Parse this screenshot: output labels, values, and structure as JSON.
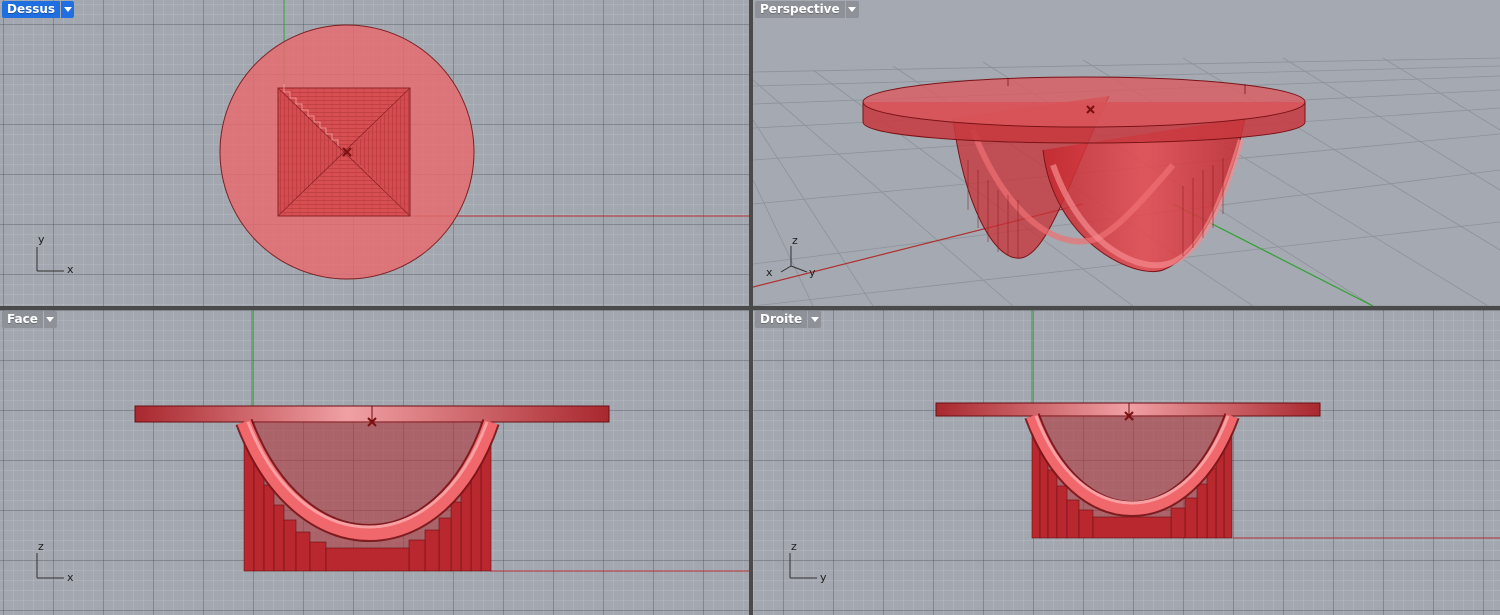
{
  "viewports": {
    "top": {
      "title": "Dessus",
      "active": true,
      "axes": [
        "y",
        "x"
      ]
    },
    "perspective": {
      "title": "Perspective",
      "active": false,
      "axes": [
        "z",
        "x",
        "y"
      ]
    },
    "front": {
      "title": "Face",
      "active": false,
      "axes": [
        "z",
        "x"
      ]
    },
    "right": {
      "title": "Droite",
      "active": false,
      "axes": [
        "z",
        "y"
      ]
    }
  },
  "colors": {
    "viewport_bg": "#a3a8b0",
    "active_tab": "#1f6fe0",
    "inactive_tab": "#8e9298",
    "object_fill": "#e05a5a",
    "x_axis": "#b03030",
    "y_axis": "#30a030"
  },
  "icons": [
    "dropdown-arrow-icon",
    "object-origin-marker-icon",
    "axis-gizmo-icon"
  ]
}
